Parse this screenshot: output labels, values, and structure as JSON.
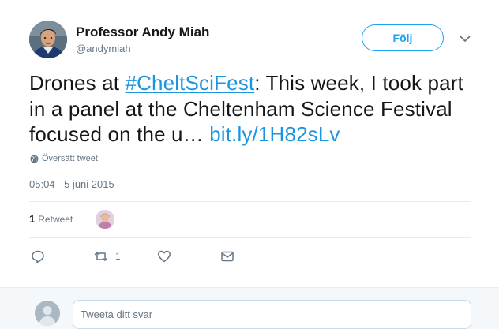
{
  "author": {
    "name": "Professor Andy Miah",
    "handle": "@andymiah"
  },
  "follow_button": {
    "label": "Följ"
  },
  "tweet": {
    "text_prefix": "Drones at ",
    "hashtag": "#CheltSciFest",
    "text_middle": ": This week, I took part in a panel at the Cheltenham Science Festival focused on the u… ",
    "link": "bit.ly/1H82sLv"
  },
  "translate": {
    "label": "Översätt tweet"
  },
  "timestamp": "05:04 - 5 juni 2015",
  "stats": {
    "retweet_count": "1",
    "retweet_label": "Retweet"
  },
  "actions": {
    "reply_icon": "reply-icon",
    "retweet_icon": "retweet-icon",
    "retweet_count": "1",
    "like_icon": "heart-icon",
    "dm_icon": "envelope-icon"
  },
  "reply": {
    "placeholder": "Tweeta ditt svar"
  },
  "colors": {
    "accent": "#1da1f2",
    "link": "#1b95e0",
    "secondary_text": "#657786",
    "divider": "#e6ecf0"
  }
}
